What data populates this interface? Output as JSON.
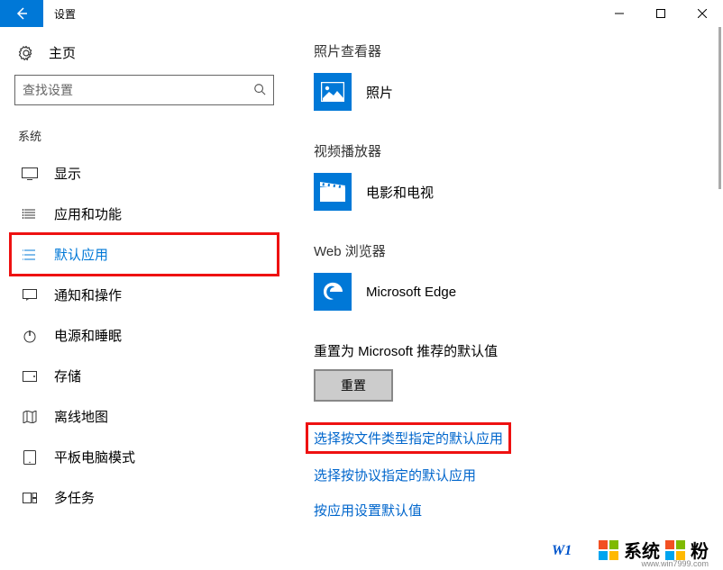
{
  "titlebar": {
    "title": "设置"
  },
  "sidebar": {
    "home_label": "主页",
    "search_placeholder": "查找设置",
    "section_label": "系统",
    "items": [
      {
        "label": "显示",
        "icon": "display"
      },
      {
        "label": "应用和功能",
        "icon": "apps"
      },
      {
        "label": "默认应用",
        "icon": "default-apps",
        "active": true,
        "highlighted": true
      },
      {
        "label": "通知和操作",
        "icon": "notifications"
      },
      {
        "label": "电源和睡眠",
        "icon": "power"
      },
      {
        "label": "存储",
        "icon": "storage"
      },
      {
        "label": "离线地图",
        "icon": "maps"
      },
      {
        "label": "平板电脑模式",
        "icon": "tablet"
      },
      {
        "label": "多任务",
        "icon": "multitask"
      }
    ]
  },
  "main": {
    "groups": [
      {
        "header": "照片查看器",
        "app": "照片",
        "icon": "photos"
      },
      {
        "header": "视频播放器",
        "app": "电影和电视",
        "icon": "movies"
      },
      {
        "header": "Web 浏览器",
        "app": "Microsoft Edge",
        "icon": "edge"
      }
    ],
    "reset_label": "重置为 Microsoft 推荐的默认值",
    "reset_button": "重置",
    "links": [
      {
        "text": "选择按文件类型指定的默认应用",
        "highlighted": true
      },
      {
        "text": "选择按协议指定的默认应用"
      },
      {
        "text": "按应用设置默认值"
      }
    ]
  },
  "watermark": {
    "brand_a": "系统",
    "brand_b": "粉",
    "url": "www.win7999.com",
    "wlc": "W1"
  }
}
